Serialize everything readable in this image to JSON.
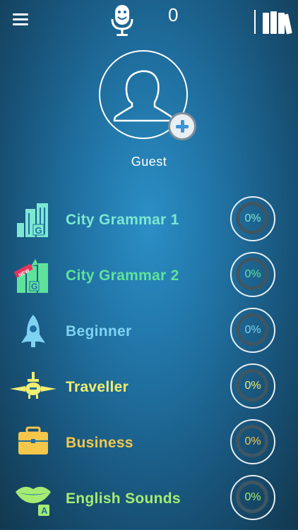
{
  "header": {
    "menu_icon": "hamburger-menu-icon",
    "mic_icon": "microphone-character-icon",
    "count": "0",
    "library_icon": "books-library-icon"
  },
  "profile": {
    "name": "Guest",
    "avatar_icon": "user-avatar-icon",
    "add_icon": "plus-icon"
  },
  "courses": [
    {
      "label": "City Grammar 1",
      "progress": "0%",
      "color": "#7de8d2",
      "icon": "city-grammar-icon"
    },
    {
      "label": "City Grammar 2",
      "progress": "0%",
      "color": "#5fe29b",
      "icon": "city-grammar-new-icon",
      "badge": "NEW"
    },
    {
      "label": "Beginner",
      "progress": "0%",
      "color": "#7fd3f2",
      "icon": "rocket-icon"
    },
    {
      "label": "Traveller",
      "progress": "0%",
      "color": "#f1ee70",
      "icon": "airplane-icon"
    },
    {
      "label": "Business",
      "progress": "0%",
      "color": "#f4c74a",
      "icon": "briefcase-icon"
    },
    {
      "label": "English Sounds",
      "progress": "0%",
      "color": "#a6ec72",
      "icon": "mouth-letter-icon",
      "icon_letter": "A"
    }
  ]
}
